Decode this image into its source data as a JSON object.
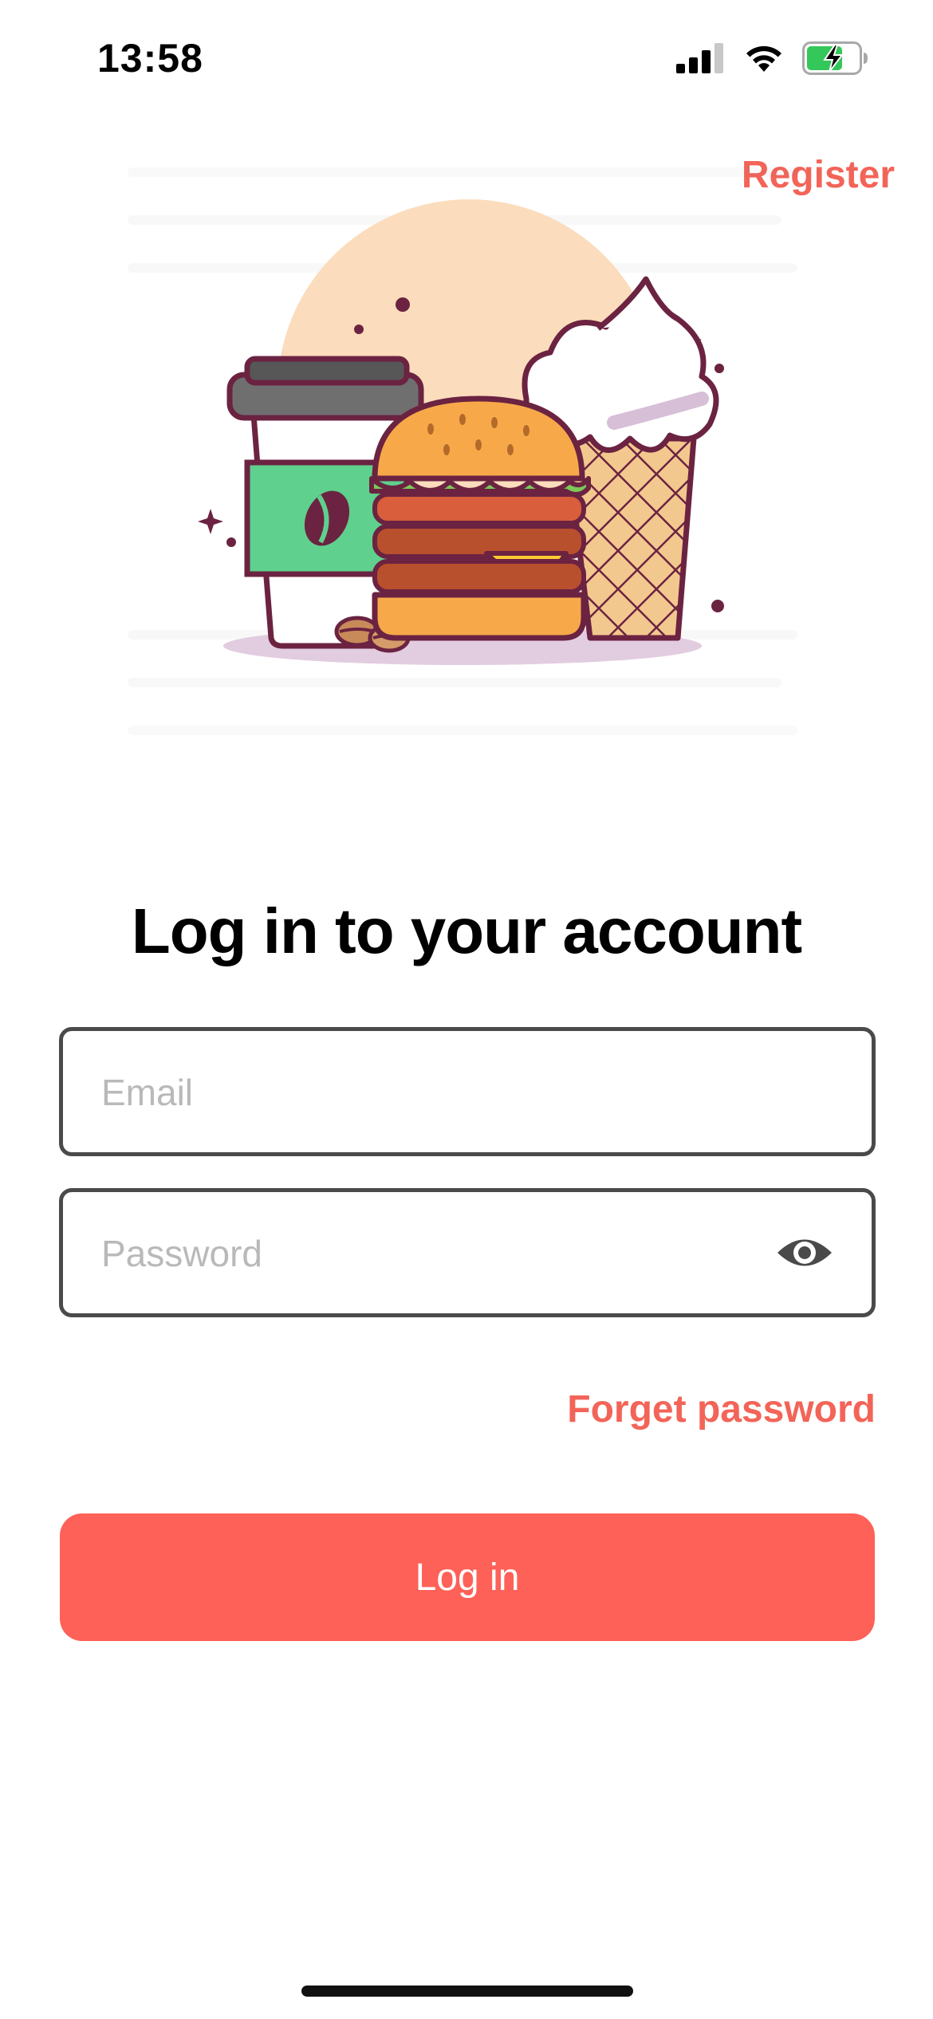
{
  "status_bar": {
    "time": "13:58",
    "icons": [
      "signal-icon",
      "wifi-icon",
      "battery-charging-icon"
    ]
  },
  "header": {
    "register_label": "Register"
  },
  "hero": {
    "image": "food-illustration",
    "items": [
      "coffee-cup",
      "burger",
      "ice-cream-cone"
    ]
  },
  "login": {
    "title": "Log in to your account",
    "email": {
      "placeholder": "Email",
      "value": ""
    },
    "password": {
      "placeholder": "Password",
      "value": ""
    },
    "forget_label": "Forget password",
    "submit_label": "Log in"
  },
  "colors": {
    "accent": "#f36458",
    "button": "#fe6158",
    "text": "#000000",
    "placeholder": "#b9b9b9",
    "border": "#4a4a4a"
  }
}
